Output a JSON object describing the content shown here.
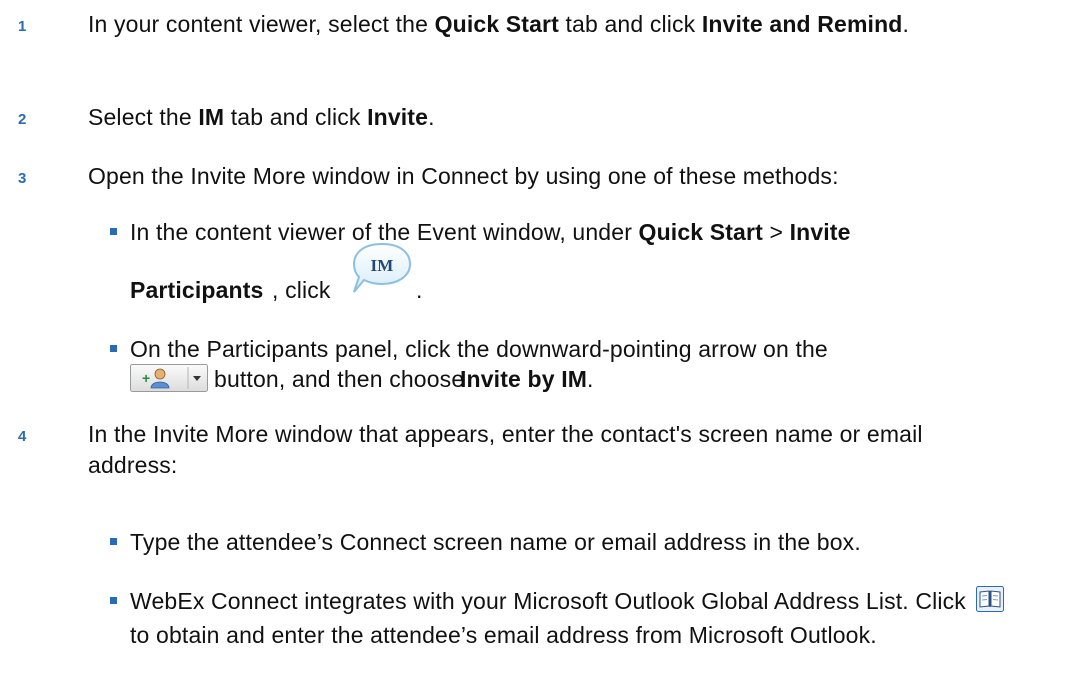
{
  "steps": [
    {
      "number": "1",
      "t1": "In your content viewer, select the ",
      "b1": "Quick Start",
      "t2": " tab and click ",
      "b2": "Invite and Remind",
      "t3": "."
    },
    {
      "number": "2",
      "t1": "Select the ",
      "b1": "IM",
      "t2": " tab and click ",
      "b2": "Invite",
      "t3": "."
    },
    {
      "number": "3",
      "text": "Open the Invite More window in Connect by using one of these methods:",
      "bullets": [
        {
          "t1": "In the content viewer of the Event window, under ",
          "b1": "Quick Start",
          "t2": " > ",
          "b2": "Invite Participants",
          "t3": ", click ",
          "t4": "."
        },
        {
          "t1": "On the Participants panel, click the downward-pointing arrow on the ",
          "t2": " button, and then choose ",
          "b1": "Invite by IM",
          "t3": "."
        }
      ]
    },
    {
      "number": "4",
      "text": "In the Invite More window that appears, enter the contact's screen name or email address:",
      "bullets": [
        {
          "text": "Type the attendee’s Connect screen name or email address in the box."
        },
        {
          "t1": "WebEx Connect integrates with your Microsoft Outlook Global Address List. Click ",
          "t2": " to obtain and enter the attendee’s email address from Microsoft Outlook."
        }
      ]
    }
  ],
  "icons": {
    "im_bubble_label": "IM",
    "im_bubble": "im-chat-bubble-icon",
    "invite_split_button": "add-participant-split-button",
    "address_book": "address-book-icon"
  },
  "colors": {
    "step_number": "#2a6bb5",
    "bullet": "#2a6bb5",
    "text": "#111111"
  }
}
